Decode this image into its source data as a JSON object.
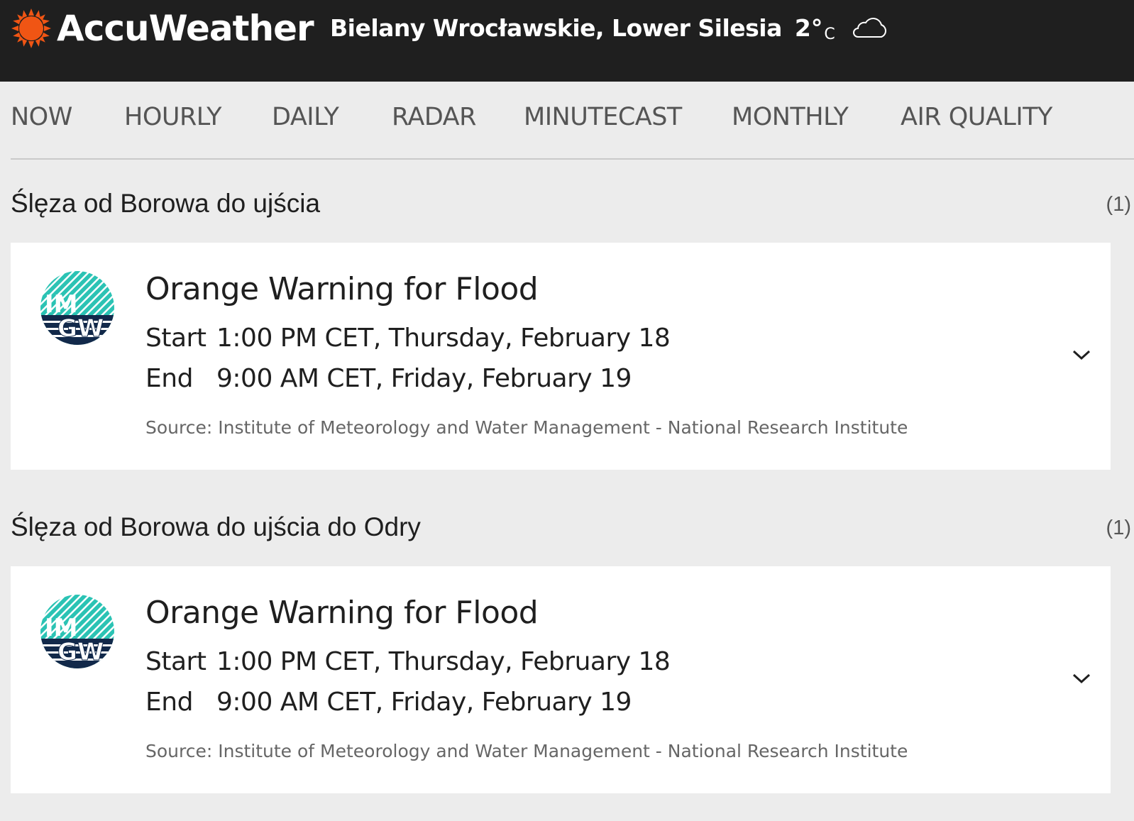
{
  "header": {
    "logo_text": "AccuWeather",
    "location": "Bielany Wrocławskie, Lower Silesia",
    "temperature": "2°",
    "temperature_unit": "C",
    "weather_icon": "cloud-icon"
  },
  "nav": {
    "items": [
      {
        "label": "NOW"
      },
      {
        "label": "HOURLY"
      },
      {
        "label": "DAILY"
      },
      {
        "label": "RADAR"
      },
      {
        "label": "MINUTECAST"
      },
      {
        "label": "MONTHLY"
      },
      {
        "label": "AIR QUALITY"
      }
    ]
  },
  "groups": [
    {
      "title": "Ślęza od Borowa do ujścia",
      "count": "(1)",
      "alert": {
        "logo_text": "IMGW",
        "title": "Orange Warning for Flood",
        "start_label": "Start",
        "start_value": "1:00 PM CET, Thursday, February 18",
        "end_label": "End",
        "end_value": "9:00 AM CET, Friday, February 19",
        "source": "Source: Institute of Meteorology and Water Management - National Research Institute"
      }
    },
    {
      "title": "Ślęza od Borowa do ujścia do Odry",
      "count": "(1)",
      "alert": {
        "logo_text": "IMGW",
        "title": "Orange Warning for Flood",
        "start_label": "Start",
        "start_value": "1:00 PM CET, Thursday, February 18",
        "end_label": "End",
        "end_value": "9:00 AM CET, Friday, February 19",
        "source": "Source: Institute of Meteorology and Water Management - National Research Institute"
      }
    }
  ],
  "colors": {
    "header_bg": "#1f1f1f",
    "brand_orange": "#f05514",
    "imgw_teal": "#2bc3b4",
    "imgw_navy": "#12294a",
    "page_bg": "#ececec"
  }
}
